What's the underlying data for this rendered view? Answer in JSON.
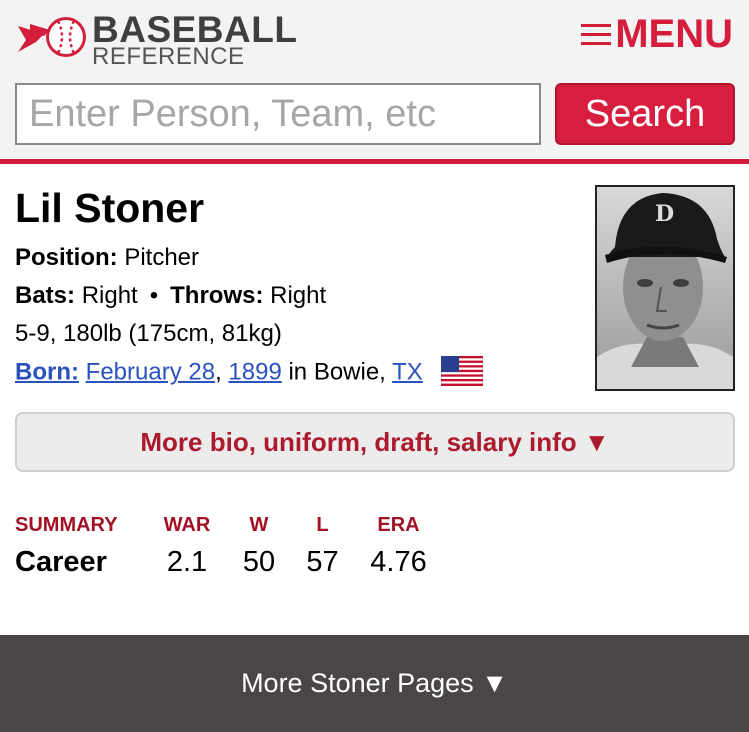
{
  "header": {
    "logo_top": "BASEBALL",
    "logo_bottom": "REFERENCE",
    "menu_label": "MENU",
    "search_placeholder": "Enter Person, Team, etc",
    "search_button": "Search",
    "brand_color": "#d41e3c"
  },
  "player": {
    "name": "Lil Stoner",
    "position_label": "Position:",
    "position": "Pitcher",
    "bats_label": "Bats:",
    "bats": "Right",
    "separator": "•",
    "throws_label": "Throws:",
    "throws": "Right",
    "size": "5-9, 180lb (175cm, 81kg)",
    "born_label": "Born:",
    "born_date": "February 28",
    "born_comma": ",",
    "born_year": "1899",
    "born_in": "in Bowie,",
    "born_state": "TX",
    "flag_icon": "us-flag-icon"
  },
  "more_bio": {
    "label": "More bio, uniform, draft, salary info ▼"
  },
  "summary": {
    "headers": [
      "SUMMARY",
      "WAR",
      "W",
      "L",
      "ERA"
    ],
    "rows": [
      [
        "Career",
        "2.1",
        "50",
        "57",
        "4.76"
      ]
    ]
  },
  "footer": {
    "label": "More Stoner Pages ▼"
  }
}
